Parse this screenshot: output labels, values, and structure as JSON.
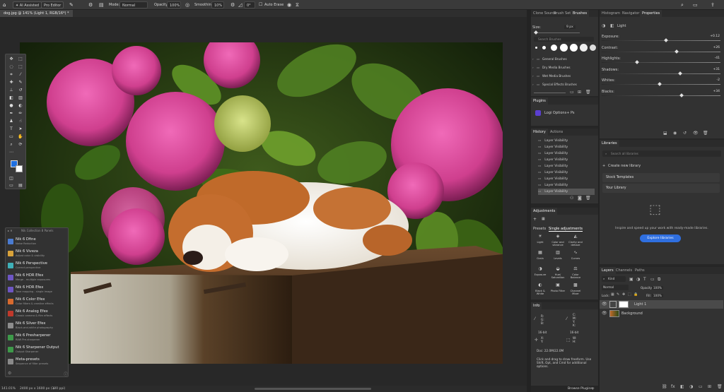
{
  "optionsBar": {
    "aiAssisted": "AI Assisted",
    "proEditor": "Pro Editor",
    "modeLabel": "Mode:",
    "modeValue": "Normal",
    "opacityLabel": "Opacity:",
    "opacityValue": "100%",
    "smoothingLabel": "Smoothing:",
    "smoothingValue": "10%",
    "angleValue": "0°",
    "autoErase": "Auto Erase"
  },
  "document": {
    "tab": "dog.jpg @ 141% (Light 1, RGB/16*) *"
  },
  "status": {
    "zoom": "141.01%",
    "size": "2400 px x 1600 px (300 ppi)"
  },
  "nik": {
    "header": "Nik Collection 8 Panels",
    "items": [
      {
        "title": "Nik 6 Dfine",
        "sub": "Noise Reduction",
        "color": "#4a7bd1"
      },
      {
        "title": "Nik 6 Viveza",
        "sub": "Adjust color & visibility",
        "color": "#d9a23a"
      },
      {
        "title": "Nik 6 Perspective",
        "sub": "Correct perspective",
        "color": "#3fb0b8"
      },
      {
        "title": "Nik 6 HDR Efex",
        "sub": "Merge - multiple exposures",
        "color": "#6e56c4"
      },
      {
        "title": "Nik 6 HDR Efex",
        "sub": "Tone mapping - single image",
        "color": "#6e56c4"
      },
      {
        "title": "Nik 6 Color Efex",
        "sub": "Color filters & creative effects",
        "color": "#d86a2e"
      },
      {
        "title": "Nik 6 Analog Efex",
        "sub": "Classic camera & film effects",
        "color": "#c0392b"
      },
      {
        "title": "Nik 6 Silver Efex",
        "sub": "Black-and-white photography",
        "color": "#8d8d8d"
      },
      {
        "title": "Nik 6 Presharpener",
        "sub": "RAW Pre-sharpener",
        "color": "#3e9a4a"
      },
      {
        "title": "Nik 6 Sharpener Output",
        "sub": "Output Sharpener",
        "color": "#3e9a4a"
      },
      {
        "title": "Meta-presets",
        "sub": "Sequence of filter presets",
        "color": "#8a8a8a"
      }
    ]
  },
  "brushes": {
    "tabs": [
      "Clone Source",
      "Brush Settin",
      "Brushes"
    ],
    "sizeLabel": "Size:",
    "sizeValue": "9 px",
    "searchPlaceholder": "Search Brushes",
    "groups": [
      "General Brushes",
      "Dry Media Brushes",
      "Wet Media Brushes",
      "Special Effects Brushes"
    ]
  },
  "plugins": {
    "title": "Plugins",
    "item": "Logi Options+ Ps"
  },
  "history": {
    "tabs": [
      "History",
      "Actions"
    ],
    "items": [
      "Layer Visibility",
      "Layer Visibility",
      "Layer Visibility",
      "Layer Visibility",
      "Layer Visibility",
      "Layer Visibility",
      "Layer Visibility",
      "Layer Visibility",
      "Layer Visibility"
    ]
  },
  "adjustments": {
    "title": "Adjustments",
    "tabs": [
      "Presets",
      "Single adjustments"
    ],
    "cells": [
      "Light",
      "Color and vibrance",
      "Clarity and dehaze",
      "Grain",
      "Levels",
      "Curves",
      "Exposure",
      "Hue/ Saturation",
      "Color Balance",
      "Black & White",
      "Photo Filter",
      "Channel Mixer"
    ]
  },
  "info": {
    "title": "Info",
    "labels": [
      "R:",
      "G:",
      "B:",
      "C:",
      "M:",
      "Y:",
      "K:",
      "X:",
      "Y:",
      "W:",
      "H:"
    ],
    "bits": "16-bit",
    "doc": "Doc: 22.0M/22.0M",
    "hint": "Click and drag to draw freeform. Use Shift, Opt, and Cmd for additional options."
  },
  "browse": "Browse Plugins",
  "properties": {
    "tabs": [
      "Histogram",
      "Navigator",
      "Properties"
    ],
    "layerName": "Light",
    "rows": [
      {
        "label": "Exposure:",
        "value": "+0.12",
        "pos": 0.54
      },
      {
        "label": "Contrast:",
        "value": "+26",
        "pos": 0.63
      },
      {
        "label": "Highlights:",
        "value": "-41",
        "pos": 0.3
      },
      {
        "label": "Shadows:",
        "value": "+31",
        "pos": 0.66
      },
      {
        "label": "Whites:",
        "value": "-2",
        "pos": 0.49
      },
      {
        "label": "Blacks:",
        "value": "+34",
        "pos": 0.67
      }
    ]
  },
  "libraries": {
    "title": "Libraries",
    "searchPlaceholder": "Search all libraries",
    "create": "Create new library",
    "items": [
      "Stock Templates",
      "Your Library"
    ],
    "promo": "Inspire and speed up your work with ready-made libraries.",
    "explore": "Explore libraries"
  },
  "layers": {
    "tabs": [
      "Layers",
      "Channels",
      "Paths"
    ],
    "kind": "Kind",
    "blend": "Normal",
    "opacityLabel": "Opacity:",
    "opacityValue": "100%",
    "lockLabel": "Lock:",
    "fillLabel": "Fill:",
    "fillValue": "100%",
    "list": [
      "Light 1",
      "Background"
    ]
  },
  "colors": {
    "foreground": "#1f6fe0",
    "background": "#ffffff",
    "explore": "#2f6fe0"
  }
}
